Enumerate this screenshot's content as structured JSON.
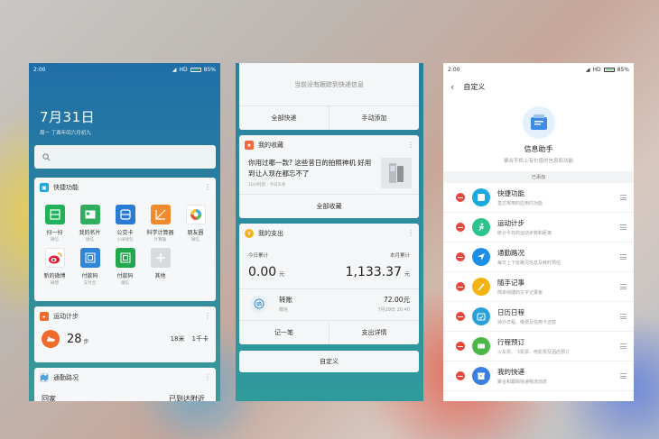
{
  "phone1": {
    "status": {
      "time": "2:00",
      "hd": "HD",
      "battery": "85%"
    },
    "date": "7月31日",
    "date_sub": "周一 丁酉年闰六月初九",
    "quick_title": "快捷功能",
    "quick_items": [
      {
        "label": "扫一扫",
        "sub": "微信",
        "color": "#1fb25a",
        "icon": "scan-icon"
      },
      {
        "label": "我的名片",
        "sub": "微信",
        "color": "#2fae5e",
        "icon": "card-icon"
      },
      {
        "label": "公交卡",
        "sub": "小米钱包",
        "color": "#2a7bd6",
        "icon": "bus-card-icon"
      },
      {
        "label": "科学计算器",
        "sub": "计算器",
        "color": "#f08a2c",
        "icon": "calculator-icon"
      },
      {
        "label": "朋友圈",
        "sub": "微信",
        "color": "#ffffff",
        "icon": "moments-icon"
      },
      {
        "label": "新的微博",
        "sub": "微博",
        "color": "#ffffff",
        "icon": "weibo-icon"
      },
      {
        "label": "付款码",
        "sub": "支付宝",
        "color": "#2f86d6",
        "icon": "pay-code-icon"
      },
      {
        "label": "付款码",
        "sub": "微信",
        "color": "#21a84f",
        "icon": "pay-code-icon"
      },
      {
        "label": "其他",
        "sub": "",
        "color": "#d7dbdd",
        "icon": "plus-icon"
      }
    ],
    "steps_title": "运动计步",
    "steps_value": "28",
    "steps_unit": "步",
    "steps_distance": "18米",
    "steps_kcal": "1千卡",
    "commute_title": "通勤路况",
    "commute_from": "回家",
    "commute_to": "已到达附近"
  },
  "phone2": {
    "no_tracking": "当前没有跟踪到快递信息",
    "btn_all_express": "全部快递",
    "btn_manual_add": "手动添加",
    "fav_title": "我的收藏",
    "fav_text": "你用过哪一款? 这些昔日的拍照神机 好用到让人现在都忘不了",
    "fav_meta": "10小时前 · 今日头条",
    "btn_all_fav": "全部收藏",
    "spend_title": "我的支出",
    "today_label": "今日累计",
    "today_value": "0.00",
    "today_unit": "元",
    "month_label": "本月累计",
    "month_value": "1,133.37",
    "month_unit": "元",
    "tx_title": "转账",
    "tx_source": "微信",
    "tx_amount": "72.00元",
    "tx_time": "7月29日 20:40",
    "btn_record": "记一笔",
    "btn_detail": "支出详情",
    "btn_customize": "自定义"
  },
  "phone3": {
    "status": {
      "time": "2:00",
      "hd": "HD",
      "battery": "85%"
    },
    "back_title": "自定义",
    "hero_title": "信息助手",
    "hero_sub": "聚合手机上有价值的信息和功能",
    "section_label": "已添加",
    "items": [
      {
        "title": "快捷功能",
        "sub": "直达常用的应用内功能",
        "color": "#1aa8e0",
        "icon": "shortcut-icon"
      },
      {
        "title": "运动计步",
        "sub": "统计今日的运动步数和距离",
        "color": "#2cc48a",
        "icon": "run-icon"
      },
      {
        "title": "通勤路况",
        "sub": "每日上下班路况信息及耗时预估",
        "color": "#1c8ee6",
        "icon": "navigate-icon"
      },
      {
        "title": "随手记事",
        "sub": "简单快捷的文字记录板",
        "color": "#f5b312",
        "icon": "pencil-icon"
      },
      {
        "title": "日历日程",
        "sub": "待办日程、缴费及信用卡还款",
        "color": "#2aa0d8",
        "icon": "calendar-icon"
      },
      {
        "title": "行程预订",
        "sub": "火车票、飞机票、电影票及酒店预订",
        "color": "#4cb848",
        "icon": "ticket-icon"
      },
      {
        "title": "我的快递",
        "sub": "聚合和跟踪快递物流动态",
        "color": "#3b7fe0",
        "icon": "package-icon"
      }
    ]
  }
}
